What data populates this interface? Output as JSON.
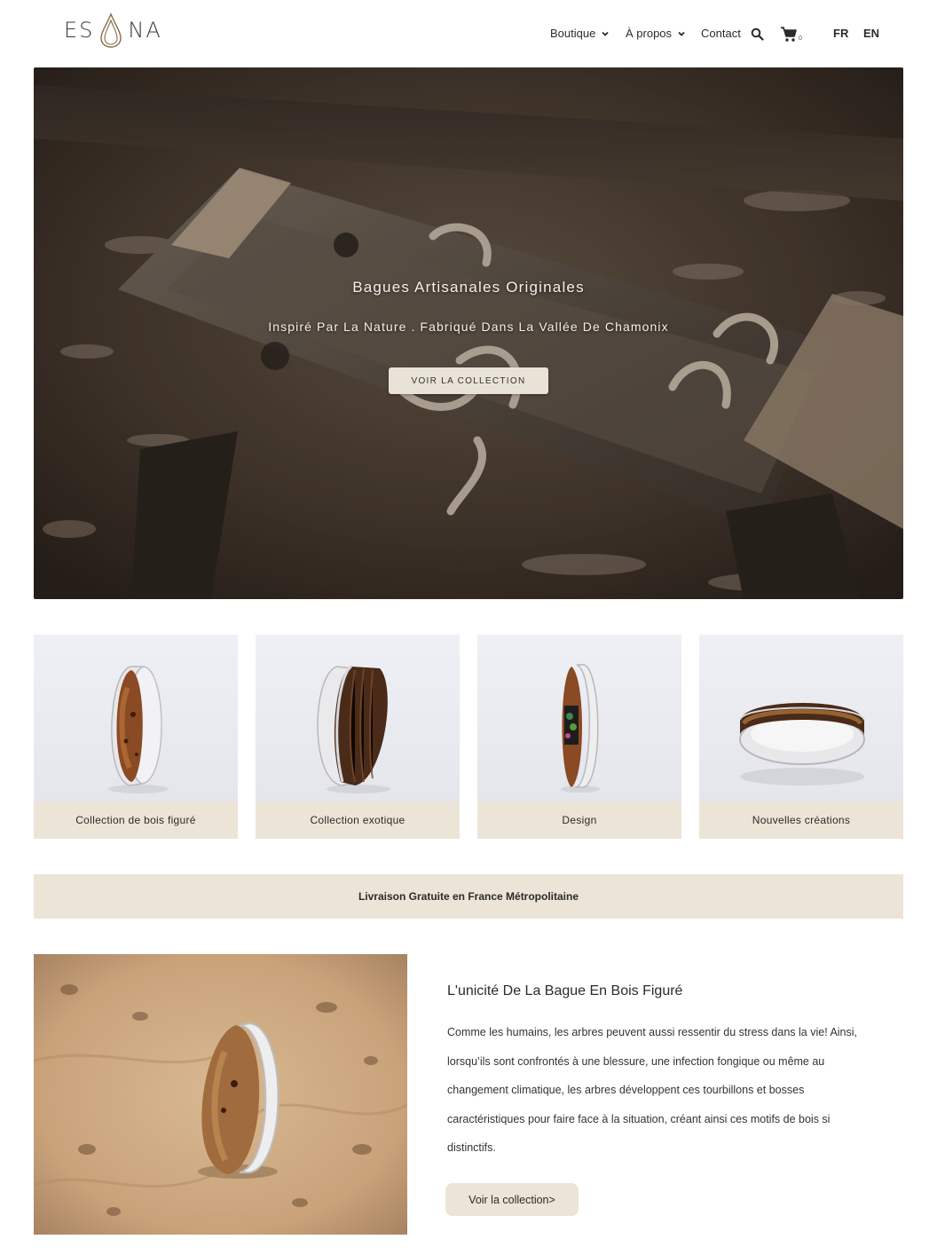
{
  "header": {
    "logo_left": "ES",
    "logo_right": "NA",
    "nav": {
      "boutique": "Boutique",
      "apropos": "À propos",
      "contact": "Contact"
    },
    "cart_count": "0",
    "languages": [
      "FR",
      "EN"
    ]
  },
  "hero": {
    "title": "Bagues Artisanales Originales",
    "subtitle": "Inspiré Par La Nature . Fabriqué Dans La Vallée De Chamonix",
    "button": "VOIR LA COLLECTION"
  },
  "collections": [
    {
      "label": "Collection de bois figuré"
    },
    {
      "label": "Collection exotique"
    },
    {
      "label": "Design"
    },
    {
      "label": "Nouvelles créations"
    }
  ],
  "banner": {
    "text": "Livraison Gratuite en France Métropolitaine"
  },
  "feature": {
    "title": "L'unicité De La Bague En Bois Figuré",
    "text": "Comme les humains, les arbres peuvent aussi ressentir du stress dans la vie! Ainsi, lorsqu’ils sont confrontés à une blessure, une infection fongique ou même au changement climatique, les arbres développent ces tourbillons et bosses caractéristiques pour faire face à la situation, créant ainsi ces motifs de bois si distinctifs.",
    "button": "Voir la collection>"
  },
  "colors": {
    "beige": "#ece4d6",
    "text": "#2b2b2b"
  },
  "icons": {
    "logo": "water-drop-outline-icon",
    "search": "search-icon",
    "cart": "shopping-cart-icon",
    "chevron": "chevron-down-icon"
  }
}
